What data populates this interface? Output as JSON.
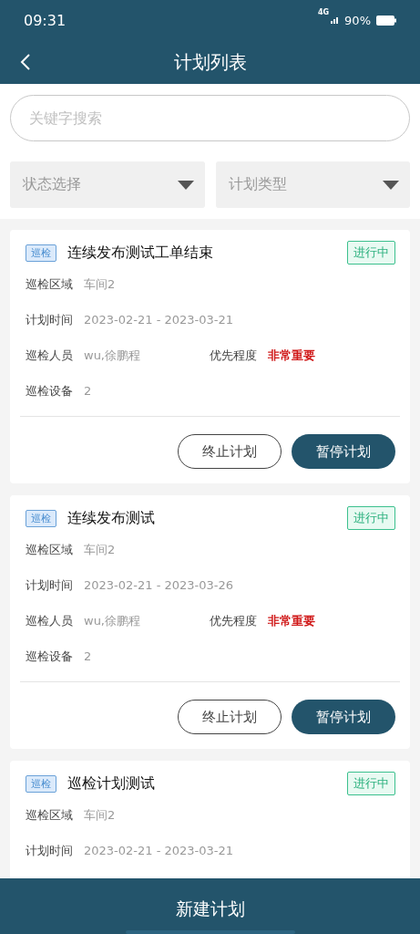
{
  "status_bar": {
    "time": "09:31",
    "network": "4G",
    "battery": "90%"
  },
  "nav": {
    "title": "计划列表"
  },
  "search": {
    "placeholder": "关键字搜索"
  },
  "filters": [
    {
      "label": "状态选择"
    },
    {
      "label": "计划类型"
    }
  ],
  "plans": [
    {
      "tag": "巡检",
      "title": "连续发布测试工单结束",
      "status": "进行中",
      "rows": [
        [
          {
            "label": "巡检区域",
            "value": "车间2",
            "important": false
          }
        ],
        [
          {
            "label": "计划时间",
            "value": "2023-02-21 - 2023-03-21",
            "important": false
          }
        ],
        [
          {
            "label": "巡检人员",
            "value": "wu,徐鹏程",
            "important": false
          },
          {
            "label": "优先程度",
            "value": "非常重要",
            "important": true
          }
        ],
        [
          {
            "label": "巡检设备",
            "value": "2",
            "important": false
          }
        ]
      ],
      "actions": [
        {
          "label": "终止计划",
          "kind": "outline"
        },
        {
          "label": "暂停计划",
          "kind": "filled"
        }
      ]
    },
    {
      "tag": "巡检",
      "title": "连续发布测试",
      "status": "进行中",
      "rows": [
        [
          {
            "label": "巡检区域",
            "value": "车间2",
            "important": false
          }
        ],
        [
          {
            "label": "计划时间",
            "value": "2023-02-21 - 2023-03-26",
            "important": false
          }
        ],
        [
          {
            "label": "巡检人员",
            "value": "wu,徐鹏程",
            "important": false
          },
          {
            "label": "优先程度",
            "value": "非常重要",
            "important": true
          }
        ],
        [
          {
            "label": "巡检设备",
            "value": "2",
            "important": false
          }
        ]
      ],
      "actions": [
        {
          "label": "终止计划",
          "kind": "outline"
        },
        {
          "label": "暂停计划",
          "kind": "filled"
        }
      ]
    },
    {
      "tag": "巡检",
      "title": "巡检计划测试",
      "status": "进行中",
      "rows": [
        [
          {
            "label": "巡检区域",
            "value": "车间2",
            "important": false
          }
        ],
        [
          {
            "label": "计划时间",
            "value": "2023-02-21 - 2023-03-21",
            "important": false
          }
        ]
      ]
    }
  ],
  "footer": {
    "button": "新建计划"
  }
}
